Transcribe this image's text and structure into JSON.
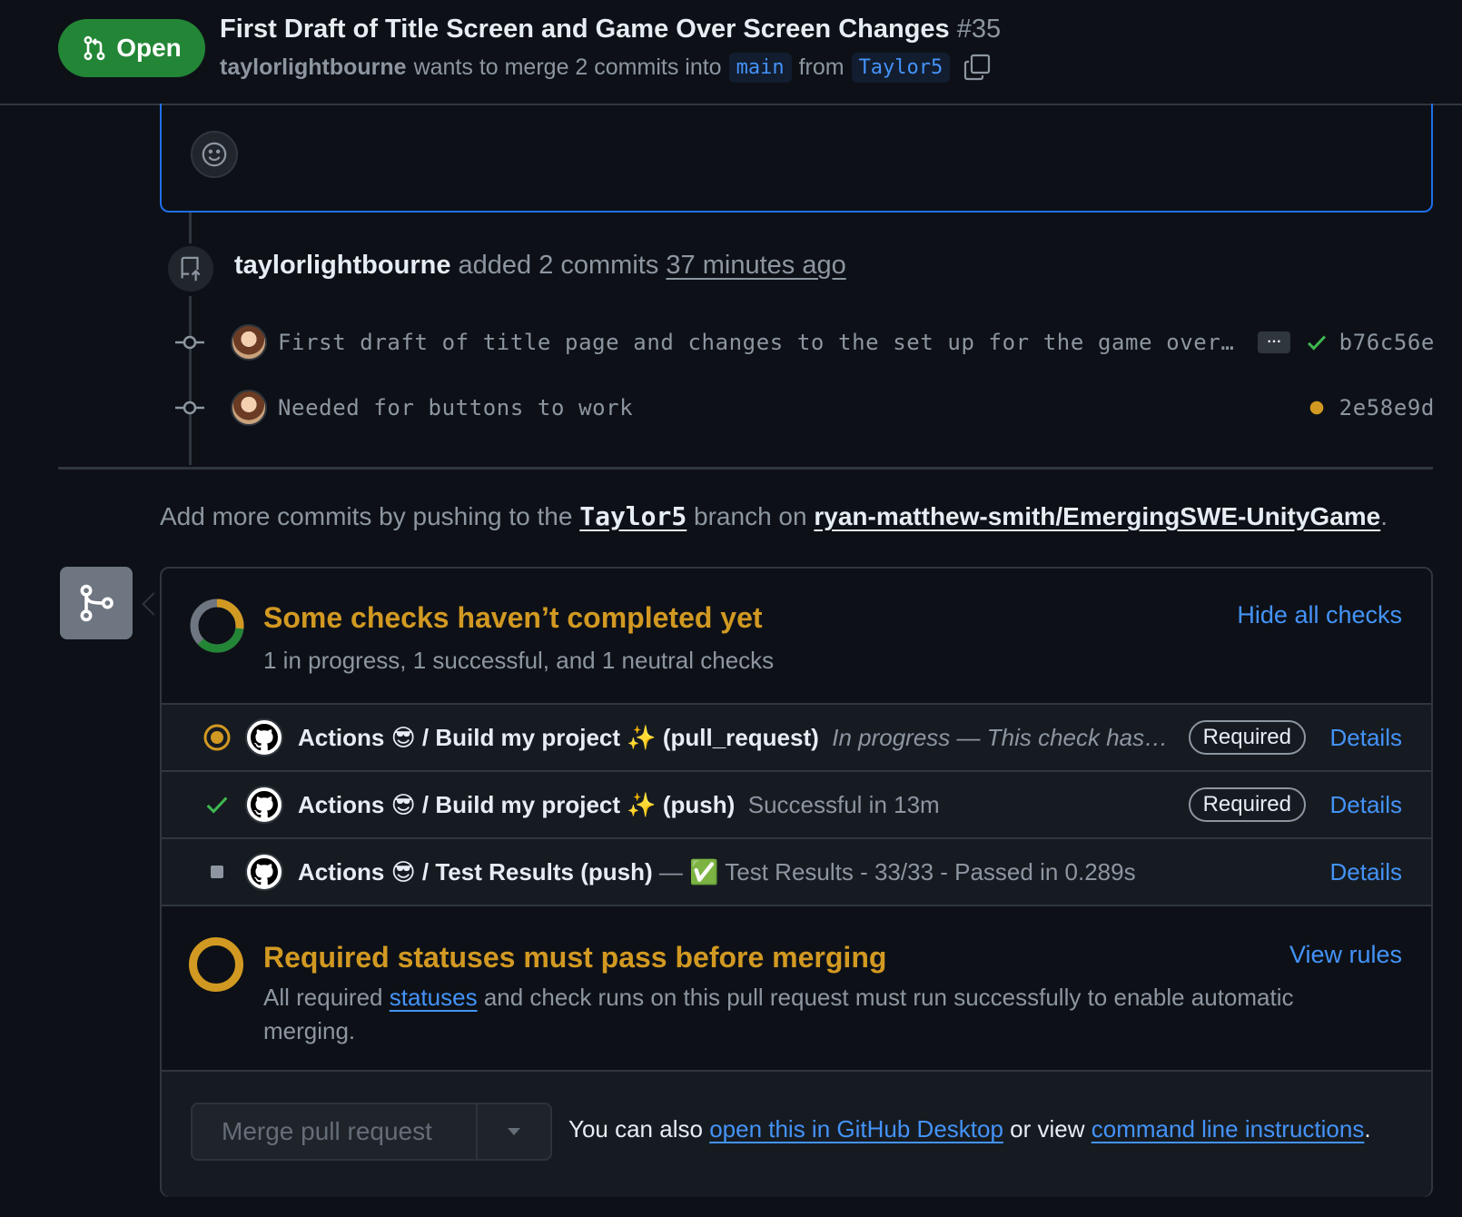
{
  "header": {
    "state": "Open",
    "title": "First Draft of Title Screen and Game Over Screen Changes",
    "number": "#35",
    "author": "taylorlightbourne",
    "merge_text": "wants to merge 2 commits into",
    "base_branch": "main",
    "from_text": "from",
    "head_branch": "Taylor5"
  },
  "timeline": {
    "push_author": "taylorlightbourne",
    "push_text": "added 2 commits",
    "push_time": "37 minutes ago",
    "commits": [
      {
        "message": "First draft of title page and changes to the set up for the game over…",
        "more": "···",
        "status": "success",
        "sha": "b76c56e"
      },
      {
        "message": "Needed for buttons to work",
        "status": "pending",
        "sha": "2e58e9d"
      }
    ]
  },
  "push_hint": {
    "prefix": "Add more commits by pushing to the",
    "branch": "Taylor5",
    "middle": "branch on",
    "repo": "ryan-matthew-smith/EmergingSWE-UnityGame",
    "suffix": "."
  },
  "checks": {
    "title": "Some checks haven’t completed yet",
    "summary": "1 in progress, 1 successful, and 1 neutral checks",
    "hide_link": "Hide all checks",
    "items": [
      {
        "name": "Actions 😎 / Build my project ✨ (pull_request)",
        "description": "In progress — This check has…",
        "status": "in_progress",
        "required": "Required",
        "details": "Details"
      },
      {
        "name": "Actions 😎 / Build my project ✨ (push)",
        "description": "Successful in 13m",
        "status": "success",
        "required": "Required",
        "details": "Details"
      },
      {
        "name": "Actions 😎 / Test Results (push)",
        "description": "— ✅ Test Results - 33/33 - Passed in 0.289s",
        "status": "neutral",
        "details": "Details"
      }
    ]
  },
  "required_statuses": {
    "title": "Required statuses must pass before merging",
    "body_prefix": "All required",
    "body_link": "statuses",
    "body_suffix": "and check runs on this pull request must run successfully to enable automatic merging.",
    "view_rules": "View rules"
  },
  "merge": {
    "button": "Merge pull request",
    "alt_prefix": "You can also",
    "desktop_link": "open this in GitHub Desktop",
    "alt_middle": "or view",
    "cli_link": "command line instructions",
    "alt_suffix": "."
  },
  "colors": {
    "background": "#0d1117",
    "open_green": "#238636",
    "pending_yellow": "#d29922",
    "link_blue": "#4493f8",
    "success_green": "#3fb950",
    "border": "#30363d"
  },
  "icons": [
    "git-pull-request-icon",
    "copy-icon",
    "smiley-icon",
    "repo-push-icon",
    "git-commit-icon",
    "check-icon",
    "dot-fill-icon",
    "git-merge-icon",
    "github-logo-icon",
    "triangle-down-icon"
  ]
}
